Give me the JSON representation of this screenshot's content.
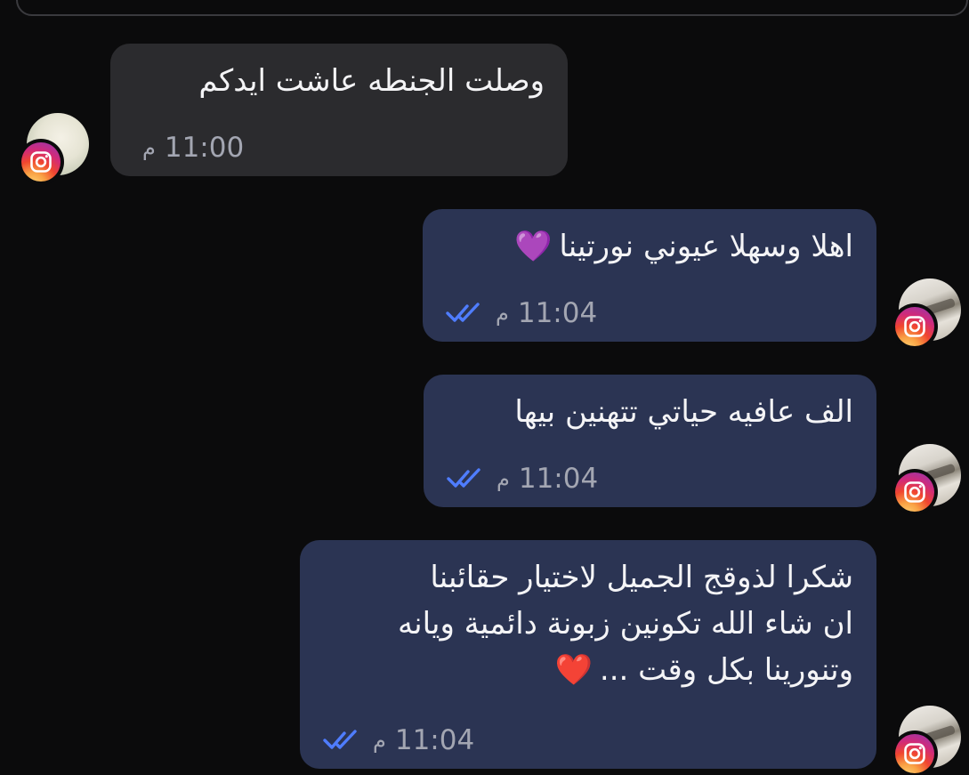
{
  "messages": [
    {
      "id": "m1",
      "direction": "incoming",
      "text": "وصلت الجنطه عاشت ايدكم",
      "time": "11:00",
      "ampm": "م",
      "read": false,
      "heart": ""
    },
    {
      "id": "m2",
      "direction": "outgoing",
      "text": "اهلا وسهلا عيوني نورتينا",
      "time": "11:04",
      "ampm": "م",
      "read": true,
      "heart": "💜"
    },
    {
      "id": "m3",
      "direction": "outgoing",
      "text": "الف عافيه حياتي تتهنين بيها",
      "time": "11:04",
      "ampm": "م",
      "read": true,
      "heart": ""
    },
    {
      "id": "m4",
      "direction": "outgoing",
      "text": "شكرا لذوقج الجميل لاختيار حقائبنا\nان شاء الله تكونين زبونة دائمية ويانه\nوتنورينا بكل وقت ...",
      "time": "11:04",
      "ampm": "م",
      "read": true,
      "heart": "❤️"
    }
  ],
  "colors": {
    "background": "#0b0b0c",
    "incoming_bubble": "#2b2b2e",
    "outgoing_bubble": "#2b3453",
    "read_ticks": "#4f7dff",
    "time_text": "#a3a6b2"
  },
  "icons": {
    "read_receipt": "double-check-icon",
    "platform_badge": "instagram-icon"
  }
}
